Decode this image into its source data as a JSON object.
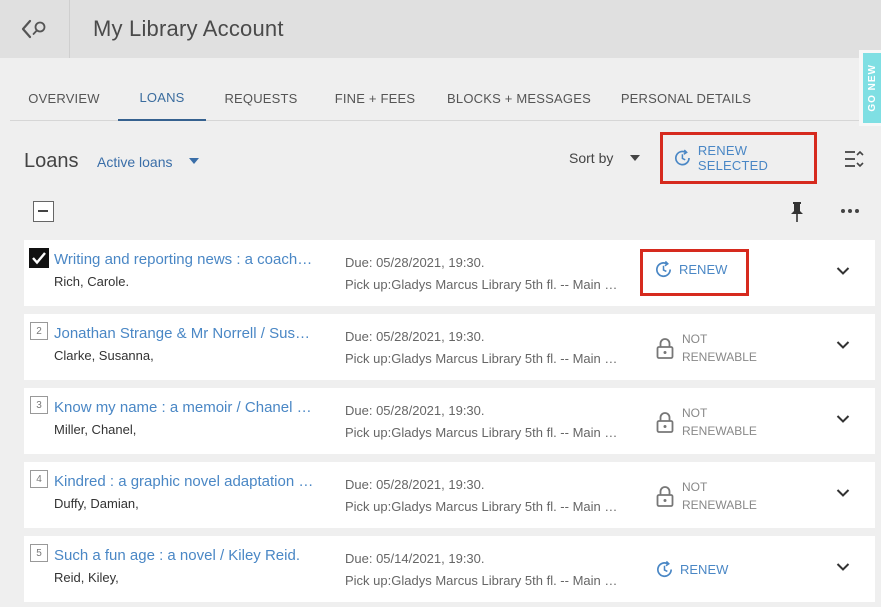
{
  "page": {
    "title": "My Library Account"
  },
  "side_tab": {
    "label": "GO NEW"
  },
  "tabs": [
    {
      "label": "OVERVIEW"
    },
    {
      "label": "LOANS"
    },
    {
      "label": "REQUESTS"
    },
    {
      "label": "FINE + FEES"
    },
    {
      "label": "BLOCKS + MESSAGES"
    },
    {
      "label": "PERSONAL DETAILS"
    }
  ],
  "active_tab": "LOANS",
  "loans": {
    "header": "Loans",
    "filter": "Active loans",
    "sort_label": "Sort by",
    "renew_selected": "RENEW SELECTED"
  },
  "items": [
    {
      "num": "1",
      "checked": true,
      "title": "Writing and reporting news : a coaching method / Carole Rich.",
      "author": "Rich, Carole.",
      "due": "Due: 05/28/2021, 19:30.",
      "pickup": "Pick up:Gladys Marcus Library 5th fl. -- Main Collection",
      "status": "RENEW",
      "renewable": true
    },
    {
      "num": "2",
      "checked": false,
      "title": "Jonathan Strange & Mr Norrell / Susanna Clarke.",
      "author": "Clarke, Susanna,",
      "due": "Due: 05/28/2021, 19:30.",
      "pickup": "Pick up:Gladys Marcus Library 5th fl. -- Main Collection",
      "status_line1": "NOT",
      "status_line2": "RENEWABLE",
      "renewable": false
    },
    {
      "num": "3",
      "checked": false,
      "title": "Know my name : a memoir / Chanel Miller.",
      "author": "Miller, Chanel,",
      "due": "Due: 05/28/2021, 19:30.",
      "pickup": "Pick up:Gladys Marcus Library 5th fl. -- Main Collection",
      "status_line1": "NOT",
      "status_line2": "RENEWABLE",
      "renewable": false
    },
    {
      "num": "4",
      "checked": false,
      "title": "Kindred : a graphic novel adaptation / Damian Duffy.",
      "author": "Duffy, Damian,",
      "due": "Due: 05/28/2021, 19:30.",
      "pickup": "Pick up:Gladys Marcus Library 5th fl. -- Main Collection",
      "status_line1": "NOT",
      "status_line2": "RENEWABLE",
      "renewable": false
    },
    {
      "num": "5",
      "checked": false,
      "title": "Such a fun age : a novel / Kiley Reid.",
      "author": "Reid, Kiley,",
      "due": "Due: 05/14/2021, 19:30.",
      "pickup": "Pick up:Gladys Marcus Library 5th fl. -- Main Collection",
      "status": "RENEW",
      "renewable": true
    }
  ],
  "colors": {
    "accent": "#4a87c5",
    "highlight": "#d62a1e",
    "tab_active": "#35618f",
    "side_tab": "#7fdfe3"
  }
}
